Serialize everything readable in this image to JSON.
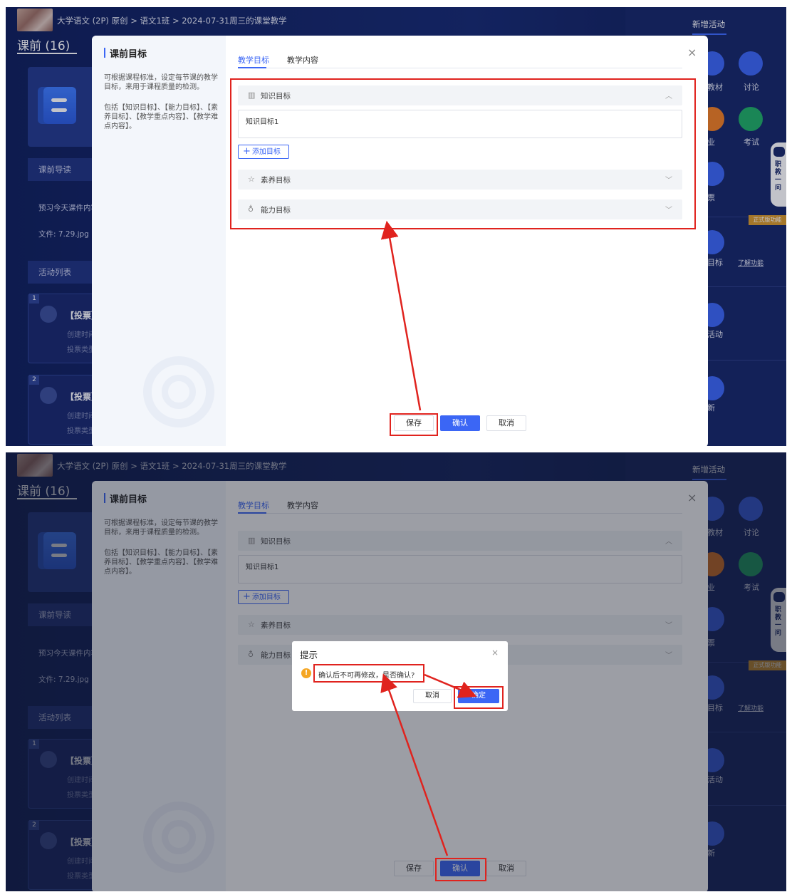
{
  "breadcrumb": "大学语文 (2P) 原创 > 语文1班 > 2024-07-31周三的课堂教学",
  "section_title": "课前 (16)",
  "left": {
    "guide_label": "课前导读",
    "preview_text": "预习今天课件内容",
    "file_text": "文件: 7.29.jpg",
    "activity_list_label": "活动列表",
    "activities": [
      {
        "num": "1",
        "title": "【投票】",
        "sub1": "创建时间",
        "sub2": "投票类型"
      },
      {
        "num": "2",
        "title": "【投票】",
        "sub1": "创建时间",
        "sub2": "投票类型"
      }
    ]
  },
  "right": {
    "new_activity": "新增活动",
    "material": "教材",
    "discussion": "讨论",
    "homework": "业",
    "exam": "考试",
    "vote": "票",
    "robot_text": "职教一问",
    "pro_tag": "正式版功能",
    "goal": "目标",
    "learn_more": "了解功能",
    "activity": "活动",
    "refresh": "新"
  },
  "modal": {
    "side_title": "课前目标",
    "side_desc1": "可根据课程标准，设定每节课的教学目标，来用于课程质量的检测。",
    "side_desc2": "包括【知识目标】、【能力目标】、【素养目标】、【教学重点内容】、【教学难点内容】。",
    "close": "×",
    "tabs": [
      "教学目标",
      "教学内容"
    ],
    "knowledge_goal": "知识目标",
    "knowledge_value": "知识目标1",
    "add_goal": "添加目标",
    "literacy_goal": "素养目标",
    "ability_goal": "能力目标",
    "save": "保存",
    "confirm": "确认",
    "cancel": "取消"
  },
  "dialog": {
    "title": "提示",
    "close": "×",
    "message": "确认后不可再修改，是否确认?",
    "cancel": "取消",
    "ok": "确定"
  },
  "colors": {
    "accent": "#3b66f5",
    "annotation": "#e0231e",
    "warning": "#f5a623"
  }
}
